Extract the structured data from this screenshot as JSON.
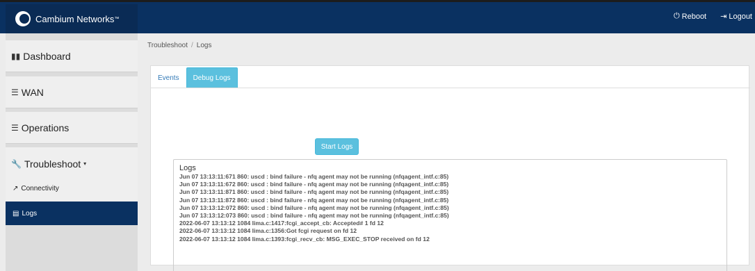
{
  "header": {
    "brand": "Cambium Networks",
    "brand_tm": "™",
    "reboot_label": "Reboot",
    "logout_label": "Logout"
  },
  "sidebar": {
    "items": [
      {
        "label": "Dashboard",
        "icon": "bar-chart-icon"
      },
      {
        "label": "WAN",
        "icon": "sliders-icon"
      },
      {
        "label": "Operations",
        "icon": "sliders-icon"
      },
      {
        "label": "Troubleshoot",
        "icon": "wrench-icon",
        "expanded": true
      }
    ],
    "subitems": [
      {
        "label": "Connectivity",
        "icon": "external-link-icon"
      },
      {
        "label": "Logs",
        "icon": "list-icon",
        "active": true
      }
    ]
  },
  "breadcrumb": {
    "parent": "Troubleshoot",
    "separator": "/",
    "current": "Logs"
  },
  "tabs": [
    {
      "label": "Events",
      "active": false
    },
    {
      "label": "Debug Logs",
      "active": true
    }
  ],
  "start_button": "Start Logs",
  "logs": {
    "title": "Logs",
    "lines": [
      "Jun 07 13:13:11:671 860: uscd : bind failure - nfq agent may not be running (nfqagent_intf.c:85)",
      "Jun 07 13:13:11:672 860: uscd : bind failure - nfq agent may not be running (nfqagent_intf.c:85)",
      "Jun 07 13:13:11:871 860: uscd : bind failure - nfq agent may not be running (nfqagent_intf.c:85)",
      "Jun 07 13:13:11:872 860: uscd : bind failure - nfq agent may not be running (nfqagent_intf.c:85)",
      "Jun 07 13:13:12:072 860: uscd : bind failure - nfq agent may not be running (nfqagent_intf.c:85)",
      "Jun 07 13:13:12:073 860: uscd : bind failure - nfq agent may not be running (nfqagent_intf.c:85)",
      "2022-06-07 13:13:12 1084 lima.c:1417:fcgi_accept_cb: Accepted# 1 fd 12",
      "2022-06-07 13:13:12 1084 lima.c:1356:Got fcgi request on fd 12",
      "2022-06-07 13:13:12 1084 lima.c:1393:fcgi_recv_cb: MSG_EXEC_STOP received on fd 12"
    ]
  },
  "colors": {
    "navbar": "#0a3161",
    "active_nav": "#0a3161",
    "accent": "#5bc0de"
  }
}
